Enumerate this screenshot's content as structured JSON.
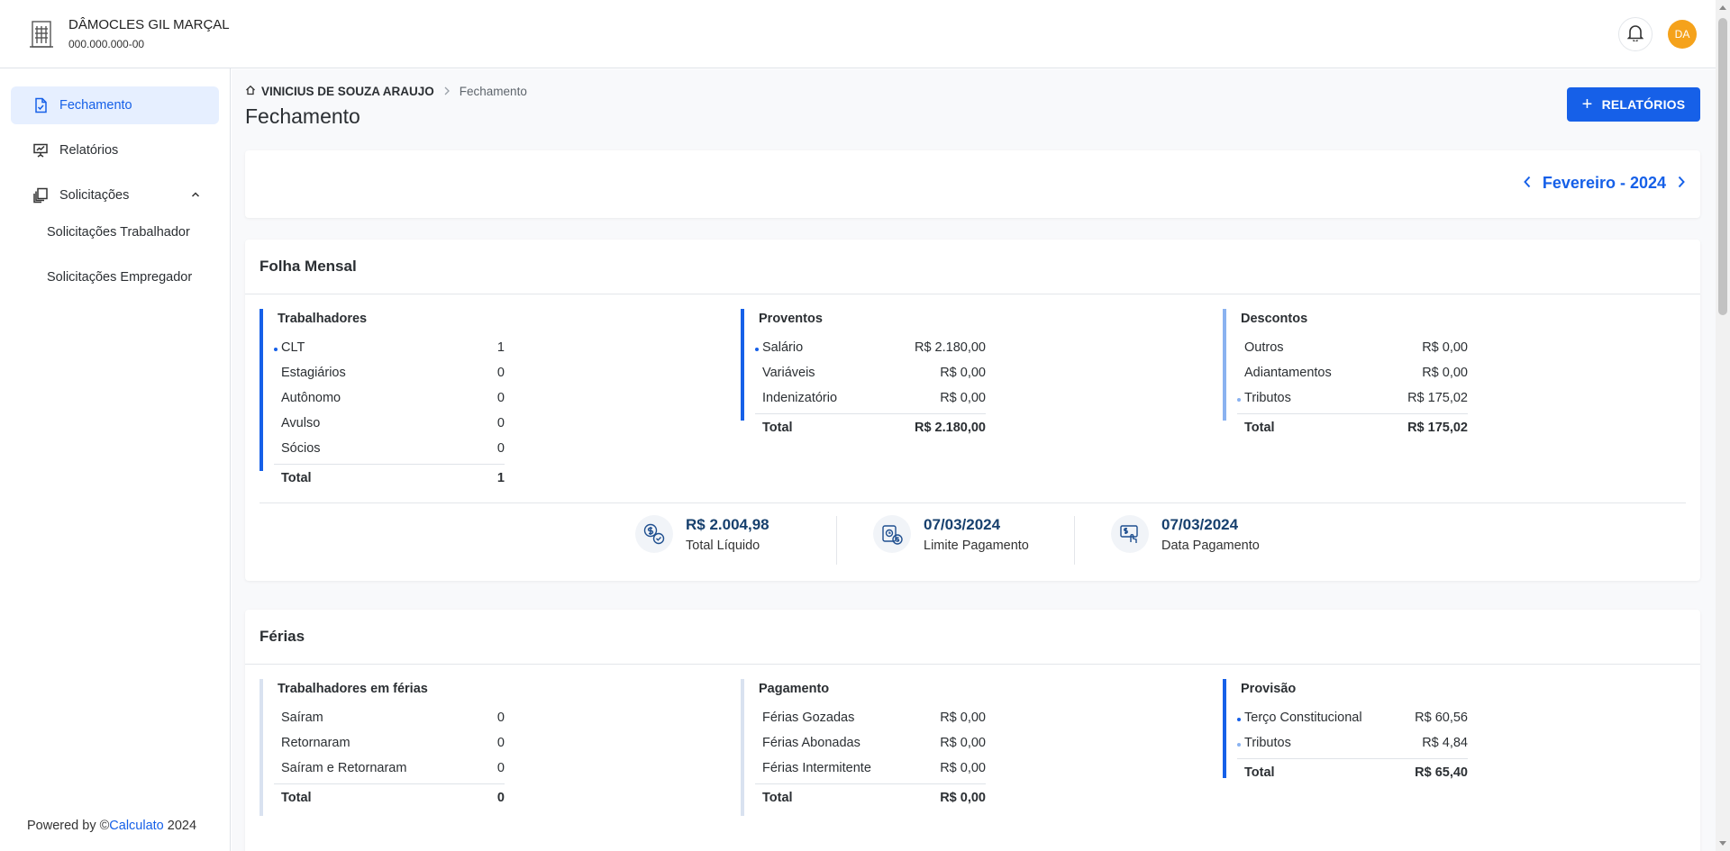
{
  "header": {
    "company_name": "DÂMOCLES GIL MARÇAL",
    "company_doc": "000.000.000-00",
    "avatar_initials": "DA"
  },
  "sidebar": {
    "items": [
      {
        "label": "Fechamento",
        "icon": "document-check-icon",
        "active": true
      },
      {
        "label": "Relatórios",
        "icon": "presentation-chart-icon",
        "active": false
      },
      {
        "label": "Solicitações",
        "icon": "documents-stack-icon",
        "active": false,
        "expanded": true
      }
    ],
    "subitems": [
      "Solicitações Trabalhador",
      "Solicitações Empregador"
    ],
    "powered_prefix": "Powered by ©",
    "powered_link": "Calculato",
    "powered_year": "2024"
  },
  "breadcrumb": {
    "root": "VINICIUS DE SOUZA ARAUJO",
    "current": "Fechamento"
  },
  "page_title": "Fechamento",
  "reports_button": "RELATÓRIOS",
  "period": "Fevereiro - 2024",
  "folha": {
    "title": "Folha Mensal",
    "trabalhadores": {
      "title": "Trabalhadores",
      "rows": [
        {
          "label": "CLT",
          "value": "1",
          "dot": true
        },
        {
          "label": "Estagiários",
          "value": "0"
        },
        {
          "label": "Autônomo",
          "value": "0"
        },
        {
          "label": "Avulso",
          "value": "0"
        },
        {
          "label": "Sócios",
          "value": "0"
        }
      ],
      "total_label": "Total",
      "total_value": "1"
    },
    "proventos": {
      "title": "Proventos",
      "rows": [
        {
          "label": "Salário",
          "value": "R$ 2.180,00",
          "dot": true
        },
        {
          "label": "Variáveis",
          "value": "R$ 0,00"
        },
        {
          "label": "Indenizatório",
          "value": "R$ 0,00"
        }
      ],
      "total_label": "Total",
      "total_value": "R$ 2.180,00"
    },
    "descontos": {
      "title": "Descontos",
      "rows": [
        {
          "label": "Outros",
          "value": "R$ 0,00"
        },
        {
          "label": "Adiantamentos",
          "value": "R$ 0,00"
        },
        {
          "label": "Tributos",
          "value": "R$ 175,02",
          "dot": true
        }
      ],
      "total_label": "Total",
      "total_value": "R$ 175,02"
    },
    "summary": [
      {
        "value": "R$ 2.004,98",
        "caption": "Total Líquido",
        "icon": "money-check-icon"
      },
      {
        "value": "07/03/2024",
        "caption": "Limite Pagamento",
        "icon": "clock-money-icon"
      },
      {
        "value": "07/03/2024",
        "caption": "Data Pagamento",
        "icon": "payment-hand-icon"
      }
    ]
  },
  "ferias": {
    "title": "Férias",
    "trabalhadores": {
      "title": "Trabalhadores em férias",
      "rows": [
        {
          "label": "Saíram",
          "value": "0"
        },
        {
          "label": "Retornaram",
          "value": "0"
        },
        {
          "label": "Saíram e Retornaram",
          "value": "0"
        }
      ],
      "total_label": "Total",
      "total_value": "0"
    },
    "pagamento": {
      "title": "Pagamento",
      "rows": [
        {
          "label": "Férias Gozadas",
          "value": "R$ 0,00"
        },
        {
          "label": "Férias Abonadas",
          "value": "R$ 0,00"
        },
        {
          "label": "Férias Intermitente",
          "value": "R$ 0,00"
        }
      ],
      "total_label": "Total",
      "total_value": "R$ 0,00"
    },
    "provisao": {
      "title": "Provisão",
      "rows": [
        {
          "label": "Terço Constitucional",
          "value": "R$ 60,56",
          "dot": true
        },
        {
          "label": "Tributos",
          "value": "R$ 4,84",
          "dot": true
        }
      ],
      "total_label": "Total",
      "total_value": "R$ 65,40"
    }
  },
  "colors": {
    "accent": "#1660e8",
    "avatar": "#f5a21b",
    "summary_value": "#17406e"
  }
}
